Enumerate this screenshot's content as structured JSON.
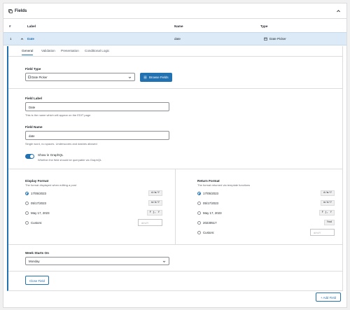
{
  "header": {
    "title": "Fields",
    "icon": "fields-icon"
  },
  "columns": {
    "num": "#",
    "label": "Label",
    "name": "Name",
    "type": "Type"
  },
  "field_row": {
    "num": "1",
    "label": "Date",
    "name": "date",
    "type": "Date Picker"
  },
  "tabs": [
    "General",
    "Validation",
    "Presentation",
    "Conditional Logic"
  ],
  "field_type": {
    "label": "Field Type",
    "value": "Date Picker",
    "browse": "Browse Fields"
  },
  "field_label": {
    "label": "Field Label",
    "value": "Date",
    "help": "This is the name which will appear on the EDIT page"
  },
  "field_name": {
    "label": "Field Name",
    "value": "date",
    "help": "Single word, no spaces. Underscores and dashes allowed"
  },
  "graphql": {
    "label": "Show in GraphQL",
    "help": "Whether the field should be queryable via GraphQL",
    "on": true
  },
  "display_format": {
    "label": "Display Format",
    "help": "The format displayed when editing a post",
    "options": [
      {
        "label": "17/05/2023",
        "code": "d/m/Y",
        "selected": true
      },
      {
        "label": "05/17/2023",
        "code": "m/d/Y",
        "selected": false
      },
      {
        "label": "May 17, 2023",
        "code": "F j, Y",
        "selected": false
      }
    ],
    "custom_label": "Custom:",
    "custom_placeholder": "d/m/Y"
  },
  "return_format": {
    "label": "Return Format",
    "help": "The format returned via template functions",
    "options": [
      {
        "label": "17/05/2023",
        "code": "d/m/Y",
        "selected": true
      },
      {
        "label": "05/17/2023",
        "code": "m/d/Y",
        "selected": false
      },
      {
        "label": "May 17, 2023",
        "code": "F j, Y",
        "selected": false
      },
      {
        "label": "20230517",
        "code": "Ymd",
        "selected": false
      }
    ],
    "custom_label": "Custom:",
    "custom_placeholder": "d/m/Y"
  },
  "week_starts": {
    "label": "Week Starts On",
    "value": "Monday"
  },
  "buttons": {
    "close": "Close Field",
    "add": "+ Add Field"
  },
  "colors": {
    "accent": "#2271b1",
    "row_bg": "#dbeaf6"
  }
}
